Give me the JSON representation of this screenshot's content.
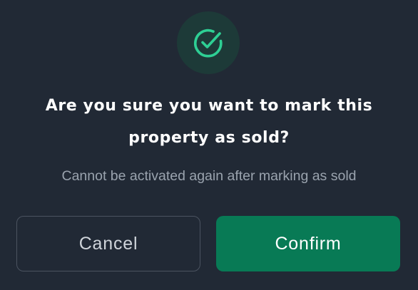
{
  "dialog": {
    "icon": "check-circle-icon",
    "title_line1": "Are you sure you want to mark this",
    "title_line2": "property as sold?",
    "subtitle": "Cannot be activated again after marking as sold",
    "cancel_label": "Cancel",
    "confirm_label": "Confirm"
  },
  "colors": {
    "background": "#212935",
    "accent": "#087a55",
    "icon_stroke": "#2ecf94",
    "icon_bg": "#1d3a38"
  }
}
